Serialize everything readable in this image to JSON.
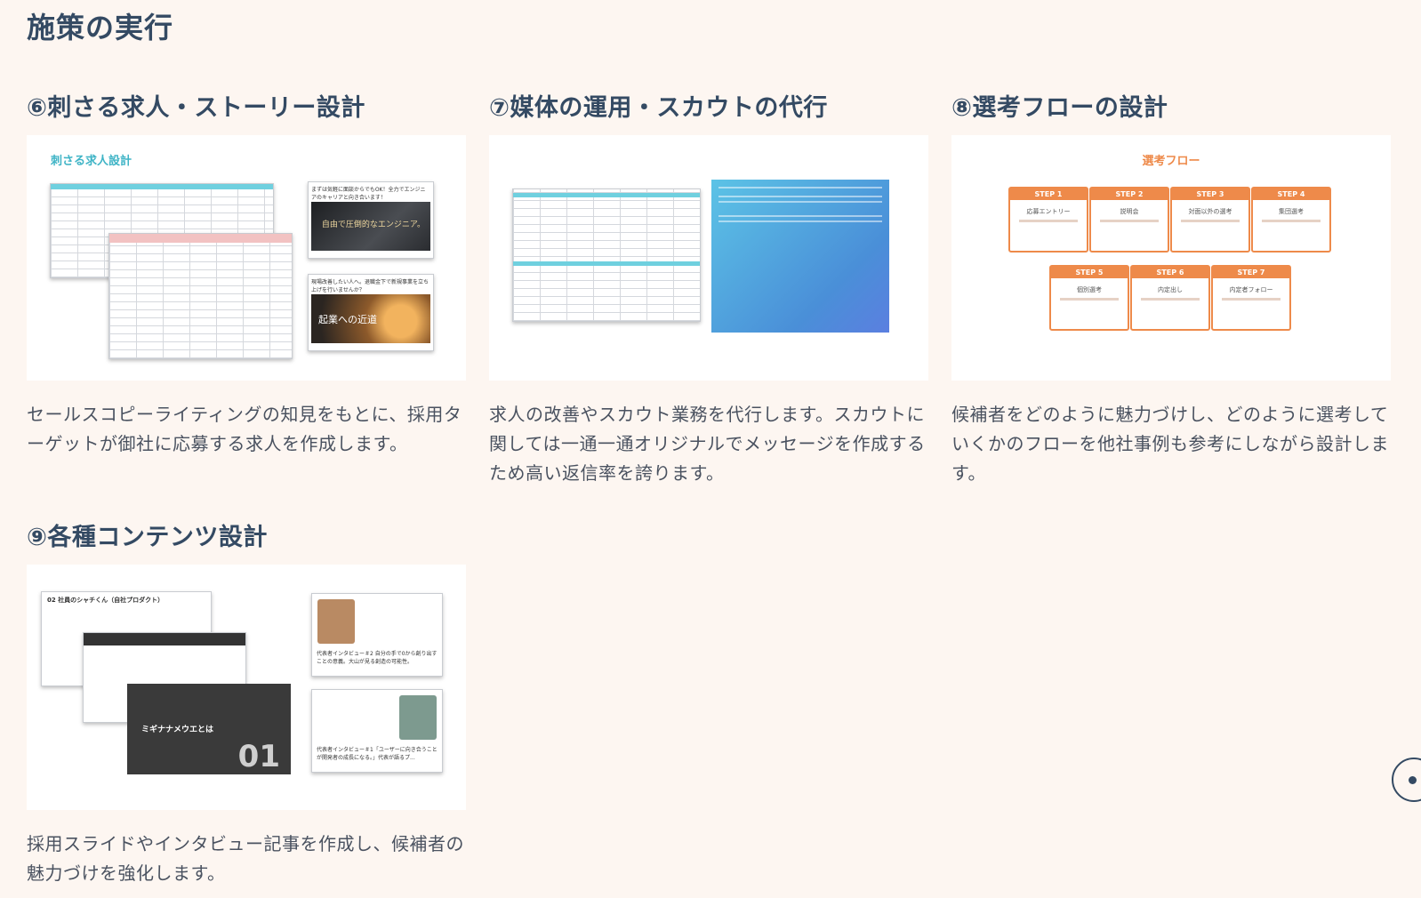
{
  "page": {
    "title": "施策の実行"
  },
  "cards": [
    {
      "title": "⑥刺さる求人・ストーリー設計",
      "description": "セールスコピーライティングの知見をもとに、採用ターゲットが御社に応募する求人を作成します。",
      "thumbnail": {
        "heading": "刺さる求人設計",
        "article1_title": "まずは気軽に面談からでもOK！全力でエンジニアのキャリアと向き合います！",
        "article1_banner": "自由で圧倒的なエンジニア。",
        "article2_title": "現場改善したい人へ。退職金下で新規事業を立ち上げを行いませんか？",
        "article2_banner": "起業への近道"
      }
    },
    {
      "title": "⑦媒体の運用・スカウトの代行",
      "description": "求人の改善やスカウト業務を代行します。スカウトに関しては一通一通オリジナルでメッセージを作成するため高い返信率を誇ります。"
    },
    {
      "title": "⑧選考フローの設計",
      "description": "候補者をどのように魅力づけし、どのように選考していくかのフローを他社事例も参考にしながら設計します。",
      "thumbnail": {
        "heading": "選考フロー",
        "steps": [
          {
            "label": "STEP 1",
            "name": "応募エントリー"
          },
          {
            "label": "STEP 2",
            "name": "説明会"
          },
          {
            "label": "STEP 3",
            "name": "対面以外の選考"
          },
          {
            "label": "STEP 4",
            "name": "集団選考"
          },
          {
            "label": "STEP 5",
            "name": "個別選考"
          },
          {
            "label": "STEP 6",
            "name": "内定出し"
          },
          {
            "label": "STEP 7",
            "name": "内定者フォロー"
          }
        ]
      }
    },
    {
      "title": "⑨各種コンテンツ設計",
      "description": "採用スライドやインタビュー記事を作成し、候補者の魅力づけを強化します。",
      "thumbnail": {
        "slide_top": "02 社員のシャチくん（自社プロダクト）",
        "slide_bottom_title": "ミギナナメウエとは",
        "slide_bottom_num": "01",
        "interview1": "代表者インタビュー＃2 自分の手で0から創り出すことの意義。大山が見る創造の可能性。",
        "interview2": "代表者インタビュー＃1「ユーザーに向き合うことが開発者の成長になる。」代表が語るプ..."
      }
    }
  ],
  "colors": {
    "title": "#344a63",
    "accent": "#ee8a4a",
    "background": "#fdf6f1"
  }
}
